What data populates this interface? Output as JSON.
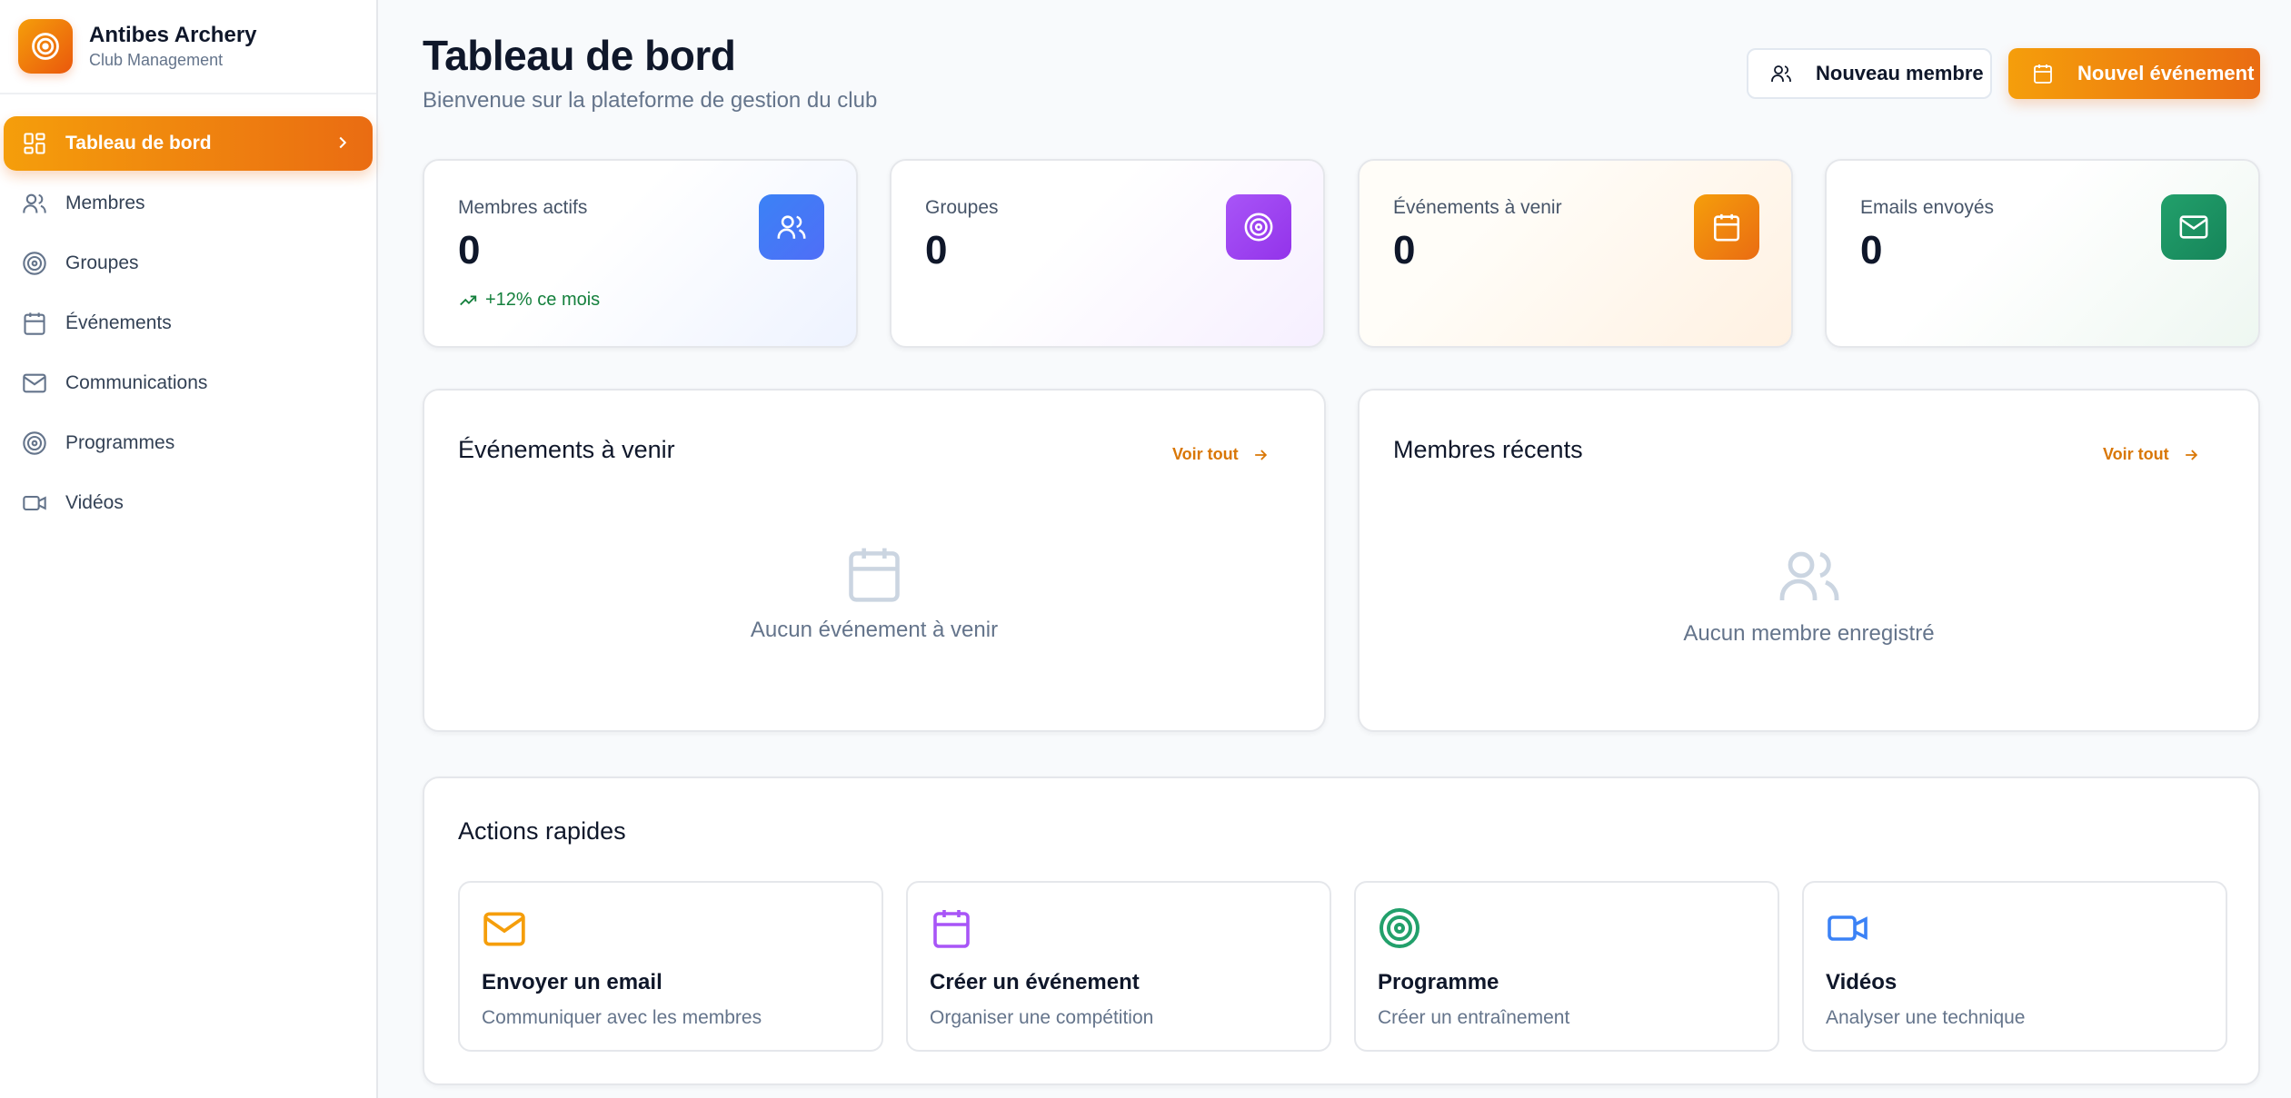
{
  "brand": {
    "title": "Antibes Archery",
    "subtitle": "Club Management",
    "accent": "#f59e0b"
  },
  "sidebar": {
    "items": [
      {
        "label": "Tableau de bord",
        "icon": "dashboard-icon",
        "active": true
      },
      {
        "label": "Membres",
        "icon": "users-icon"
      },
      {
        "label": "Groupes",
        "icon": "target-icon"
      },
      {
        "label": "Événements",
        "icon": "calendar-icon"
      },
      {
        "label": "Communications",
        "icon": "mail-icon"
      },
      {
        "label": "Programmes",
        "icon": "target-icon"
      },
      {
        "label": "Vidéos",
        "icon": "video-icon"
      }
    ]
  },
  "header": {
    "title": "Tableau de bord",
    "subtitle": "Bienvenue sur la plateforme de gestion du club",
    "new_member_label": "Nouveau membre",
    "new_event_label": "Nouvel événement"
  },
  "stats": [
    {
      "label": "Membres actifs",
      "value": "0",
      "trend": "+12% ce mois",
      "icon": "users-icon",
      "color": "#3b82f6"
    },
    {
      "label": "Groupes",
      "value": "0",
      "icon": "target-icon",
      "color": "#a855f7"
    },
    {
      "label": "Événements à venir",
      "value": "0",
      "icon": "calendar-icon",
      "color": "#f59e0b"
    },
    {
      "label": "Emails envoyés",
      "value": "0",
      "icon": "mail-icon",
      "color": "#22a06b"
    }
  ],
  "upcoming_events": {
    "title": "Événements à venir",
    "see_all": "Voir tout",
    "empty": "Aucun événement à venir"
  },
  "recent_members": {
    "title": "Membres récents",
    "see_all": "Voir tout",
    "empty": "Aucun membre enregistré"
  },
  "quick_actions": {
    "title": "Actions rapides",
    "items": [
      {
        "title": "Envoyer un email",
        "desc": "Communiquer avec les membres",
        "icon": "mail-icon",
        "color": "#f59e0b"
      },
      {
        "title": "Créer un événement",
        "desc": "Organiser une compétition",
        "icon": "calendar-icon",
        "color": "#a855f7"
      },
      {
        "title": "Programme",
        "desc": "Créer un entraînement",
        "icon": "target-icon",
        "color": "#22a06b"
      },
      {
        "title": "Vidéos",
        "desc": "Analyser une technique",
        "icon": "video-icon",
        "color": "#3b82f6"
      }
    ]
  }
}
